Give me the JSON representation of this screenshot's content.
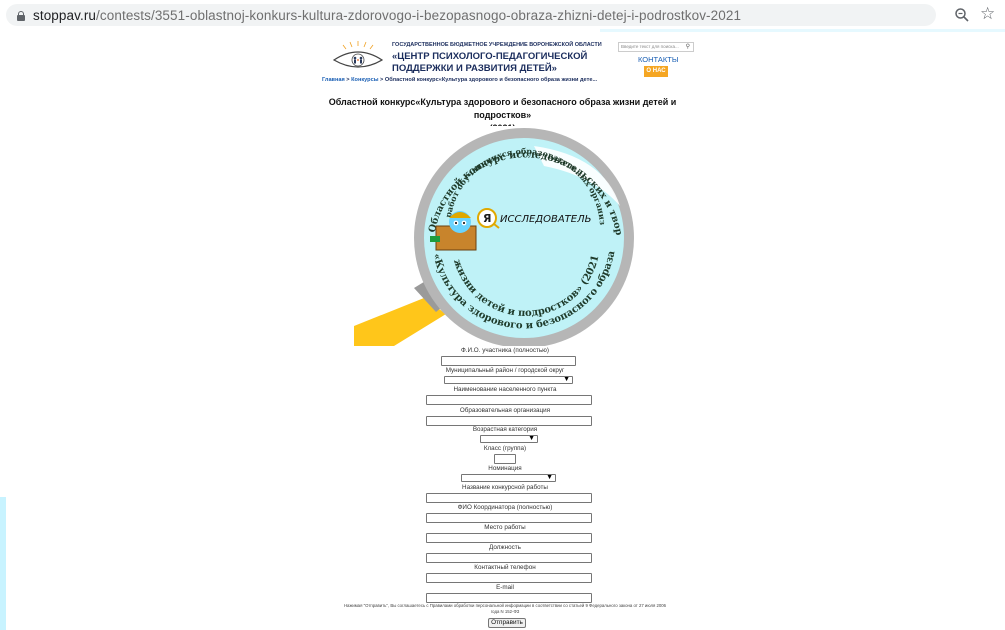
{
  "browser": {
    "url_domain": "stoppav.ru",
    "url_path": "/contests/3551-oblastnoj-konkurs-kultura-zdorovogo-i-bezopasnogo-obraza-zhizni-detej-i-podrostkov-2021"
  },
  "header": {
    "org_small": "ГОСУДАРСТВЕННОЕ БЮДЖЕТНОЕ УЧРЕЖДЕНИЕ ВОРОНЕЖСКОЙ ОБЛАСТИ",
    "org_line1": "«ЦЕНТР ПСИХОЛОГО-ПЕДАГОГИЧЕСКОЙ",
    "org_line2": "ПОДДЕРЖКИ И РАЗВИТИЯ ДЕТЕЙ»",
    "search_placeholder": "Введите текст для поиска...",
    "contacts": "КОНТАКТЫ",
    "about": "О НАС"
  },
  "breadcrumb": {
    "home": "Главная",
    "sep1": " > ",
    "contests": "Конкурсы",
    "sep2": " > ",
    "current": "Областной конкурс«Культура здорового и безопасного образа жизни дете..."
  },
  "page_title_line1": "Областной конкурс«Культура здорового и безопасного образа жизни детей и подростков»",
  "page_title_line2": "(2021)",
  "hero": {
    "arc_top": "Областной конкурс исследовательских и творческих",
    "arc_top2": "работ обучающихся образовательных организаций",
    "logo_text": "ИССЛЕДОВАТЕЛЬ",
    "logo_prefix": "Я",
    "arc_bottom": "«Культура здорового и безопасного образа",
    "arc_bottom2": "жизни детей и подростков» (2021)"
  },
  "form": {
    "fio_label": "Ф.И.О. участника (полностью)",
    "district_label": "Муниципальный район / городской округ",
    "settlement_label": "Наименование населенного пункта",
    "org_label": "Образовательная организация",
    "age_label": "Возрастная категория",
    "class_label": "Класс (группа)",
    "nomination_label": "Номинация",
    "work_title_label": "Название конкурсной работы",
    "coordinator_label": "ФИО Координатора (полностью)",
    "workplace_label": "Место работы",
    "position_label": "Должность",
    "phone_label": "Контактный телефон",
    "email_label": "E-mail",
    "consent_line1": "Нажимая \"Отправить\", Вы соглашаетесь с Правилами обработки персональной информации в соответствии со статьей 9 Федерального закона от 27 июля 2006",
    "consent_line2": "года N 152-ФЗ",
    "submit_label": "Отправить"
  },
  "colors": {
    "accent_orange": "#f5a623",
    "link_blue": "#1a5fb4",
    "lens_cyan": "#bff2f7",
    "handle_yellow": "#ffc61a"
  }
}
